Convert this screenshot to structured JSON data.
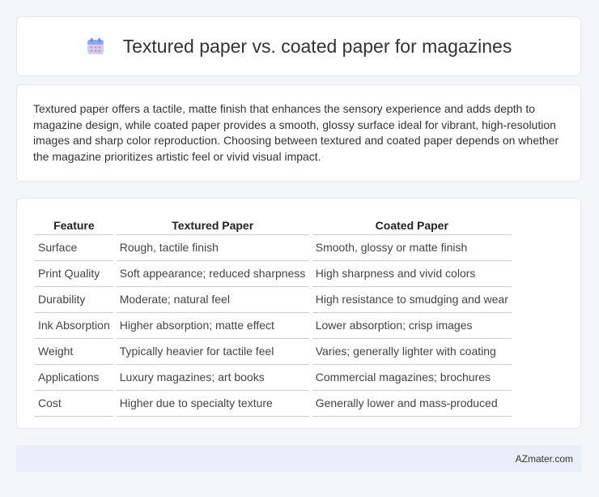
{
  "header": {
    "title": "Textured paper vs. coated paper for magazines",
    "icon": "calendar-icon"
  },
  "intro": {
    "text": "Textured paper offers a tactile, matte finish that enhances the sensory experience and adds depth to magazine design, while coated paper provides a smooth, glossy surface ideal for vibrant, high-resolution images and sharp color reproduction. Choosing between textured and coated paper depends on whether the magazine prioritizes artistic feel or vivid visual impact."
  },
  "table": {
    "headers": [
      "Feature",
      "Textured Paper",
      "Coated Paper"
    ],
    "rows": [
      [
        "Surface",
        "Rough, tactile finish",
        "Smooth, glossy or matte finish"
      ],
      [
        "Print Quality",
        "Soft appearance; reduced sharpness",
        "High sharpness and vivid colors"
      ],
      [
        "Durability",
        "Moderate; natural feel",
        "High resistance to smudging and wear"
      ],
      [
        "Ink Absorption",
        "Higher absorption; matte effect",
        "Lower absorption; crisp images"
      ],
      [
        "Weight",
        "Typically heavier for tactile feel",
        "Varies; generally lighter with coating"
      ],
      [
        "Applications",
        "Luxury magazines; art books",
        "Commercial magazines; brochures"
      ],
      [
        "Cost",
        "Higher due to specialty texture",
        "Generally lower and mass-produced"
      ]
    ]
  },
  "footer": {
    "brand": "AZmater.com"
  }
}
